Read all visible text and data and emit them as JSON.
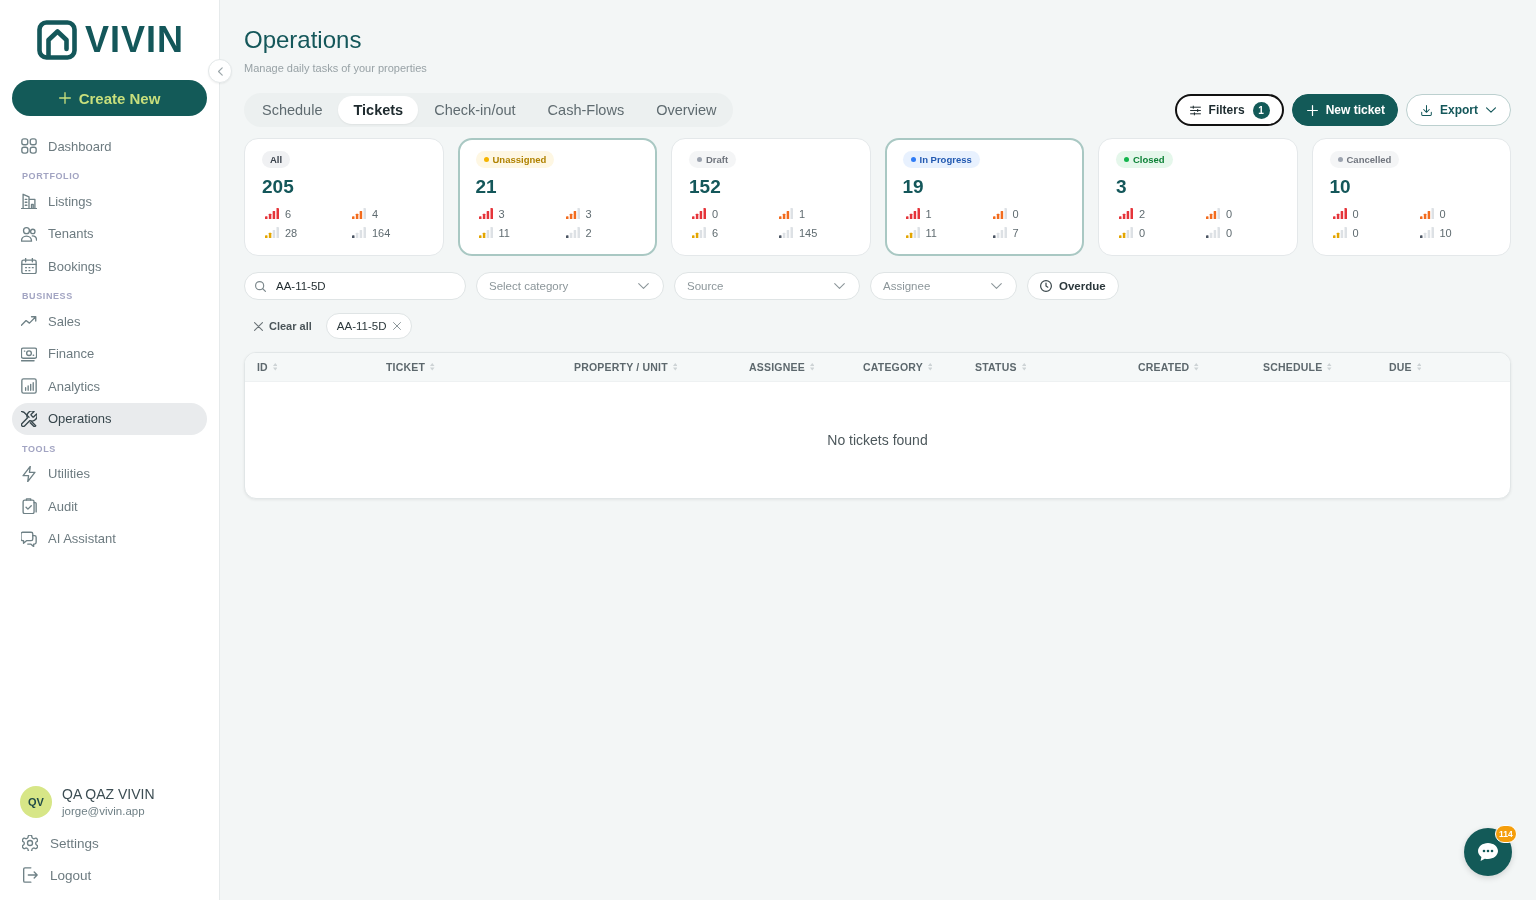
{
  "sidebar": {
    "logo": {
      "text": "VIVIN"
    },
    "create_button": {
      "label": "Create New"
    },
    "nav_groups": [
      {
        "items": [
          {
            "label": "Dashboard",
            "selected": false
          }
        ]
      },
      {
        "heading": "PORTFOLIO",
        "items": [
          {
            "label": "Listings",
            "selected": false
          },
          {
            "label": "Tenants",
            "selected": false
          },
          {
            "label": "Bookings",
            "selected": false
          }
        ]
      },
      {
        "heading": "BUSINESS",
        "items": [
          {
            "label": "Sales",
            "selected": false
          },
          {
            "label": "Finance",
            "selected": false
          },
          {
            "label": "Analytics",
            "selected": false
          },
          {
            "label": "Operations",
            "selected": true
          }
        ]
      },
      {
        "heading": "TOOLS",
        "items": [
          {
            "label": "Utilities",
            "selected": false
          },
          {
            "label": "Audit",
            "selected": false
          },
          {
            "label": "AI Assistant",
            "selected": false
          }
        ]
      }
    ],
    "user": {
      "initials": "QV",
      "name": "QA QAZ VIVIN",
      "email": "jorge@vivin.app"
    },
    "footer_items": [
      {
        "label": "Settings"
      },
      {
        "label": "Logout"
      }
    ]
  },
  "header": {
    "title": "Operations",
    "subtitle": "Manage daily tasks of your properties"
  },
  "tabs": [
    {
      "label": "Schedule",
      "selected": false
    },
    {
      "label": "Tickets",
      "selected": true
    },
    {
      "label": "Check-in/out",
      "selected": false
    },
    {
      "label": "Cash-Flows",
      "selected": false
    },
    {
      "label": "Overview",
      "selected": false
    }
  ],
  "actions": {
    "filters": {
      "label": "Filters",
      "count": "1",
      "focused": true
    },
    "new_ticket": {
      "label": "New ticket"
    },
    "export": {
      "label": "Export"
    }
  },
  "status_cards": [
    {
      "label": "All",
      "selected": false,
      "count": "205",
      "metrics": [
        {
          "kind": "urgent",
          "value": "6"
        },
        {
          "kind": "high",
          "value": "4"
        },
        {
          "kind": "medium",
          "value": "28"
        },
        {
          "kind": "low",
          "value": "164"
        }
      ]
    },
    {
      "label": "Unassigned",
      "color": "#f5b400",
      "selected": true,
      "count": "21",
      "metrics": [
        {
          "kind": "urgent",
          "value": "3"
        },
        {
          "kind": "high",
          "value": "3"
        },
        {
          "kind": "medium",
          "value": "11"
        },
        {
          "kind": "low",
          "value": "2"
        }
      ]
    },
    {
      "label": "Draft",
      "color": "#9ca3af",
      "selected": false,
      "count": "152",
      "metrics": [
        {
          "kind": "urgent",
          "value": "0"
        },
        {
          "kind": "high",
          "value": "1"
        },
        {
          "kind": "medium",
          "value": "6"
        },
        {
          "kind": "low",
          "value": "145"
        }
      ]
    },
    {
      "label": "In Progress",
      "color": "#2f7cf6",
      "selected": true,
      "count": "19",
      "metrics": [
        {
          "kind": "urgent",
          "value": "1"
        },
        {
          "kind": "high",
          "value": "0"
        },
        {
          "kind": "medium",
          "value": "11"
        },
        {
          "kind": "low",
          "value": "7"
        }
      ]
    },
    {
      "label": "Closed",
      "color": "#12b54c",
      "selected": false,
      "count": "3",
      "metrics": [
        {
          "kind": "urgent",
          "value": "2"
        },
        {
          "kind": "high",
          "value": "0"
        },
        {
          "kind": "medium",
          "value": "0"
        },
        {
          "kind": "low",
          "value": "0"
        }
      ]
    },
    {
      "label": "Cancelled",
      "color": "#9ca3af",
      "selected": false,
      "count": "10",
      "metrics": [
        {
          "kind": "urgent",
          "value": "0"
        },
        {
          "kind": "high",
          "value": "0"
        },
        {
          "kind": "medium",
          "value": "0"
        },
        {
          "kind": "low",
          "value": "10"
        }
      ]
    }
  ],
  "filters": {
    "search": {
      "value": "AA-11-5D"
    },
    "selects": [
      {
        "placeholder": "Select category"
      },
      {
        "placeholder": "Source"
      },
      {
        "placeholder": "Assignee"
      }
    ],
    "overdue": {
      "label": "Overdue"
    }
  },
  "active_filters": {
    "clear_label": "Clear all",
    "chips": [
      {
        "label": "AA-11-5D"
      }
    ]
  },
  "table": {
    "columns": [
      "ID",
      "TICKET",
      "PROPERTY / UNIT",
      "ASSIGNEE",
      "CATEGORY",
      "STATUS",
      "CREATED",
      "SCHEDULE",
      "DUE"
    ],
    "empty_message": "No tickets found"
  },
  "chat": {
    "badge": "114"
  }
}
